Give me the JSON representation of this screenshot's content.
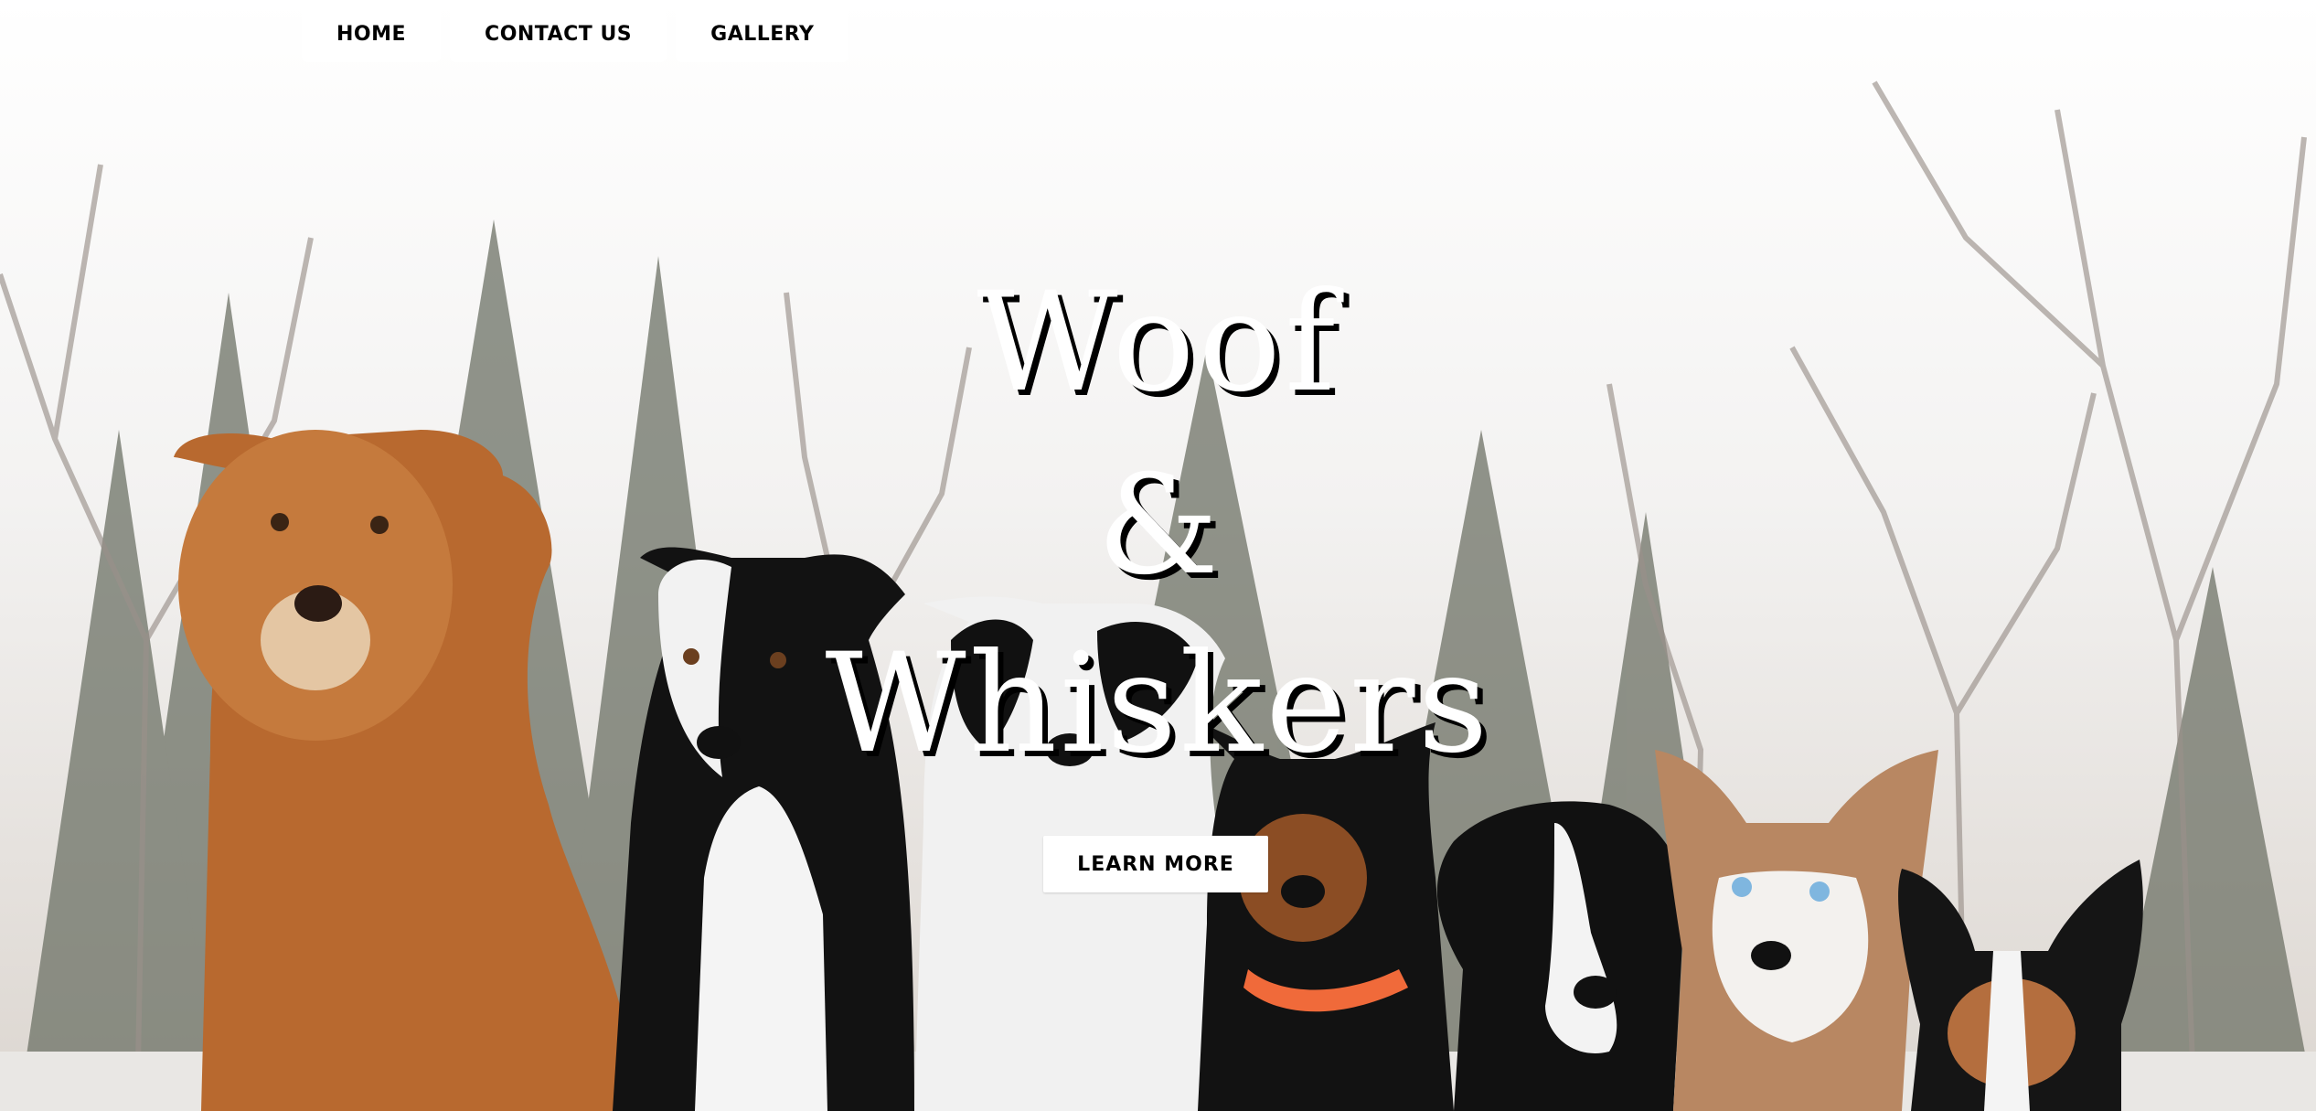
{
  "nav": {
    "items": [
      {
        "label": "HOME"
      },
      {
        "label": "CONTACT US"
      },
      {
        "label": "GALLERY"
      }
    ]
  },
  "hero": {
    "title_line1": "Woof",
    "title_line2": "&",
    "title_line3": "Whiskers",
    "cta_label": "LEARN MORE",
    "background_image": "photo of seven dogs sitting in a snowy park with bare trees and evergreens",
    "colors": {
      "title_fill": "#ffffff",
      "title_shadow": "#000000",
      "button_bg": "#ffffff",
      "button_text": "#000000"
    }
  }
}
